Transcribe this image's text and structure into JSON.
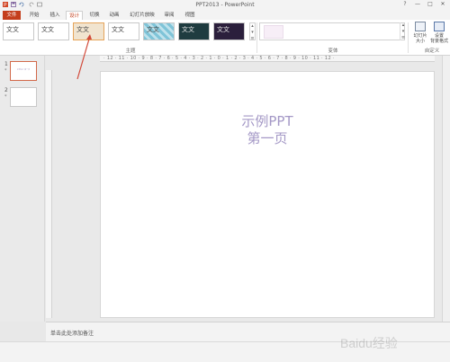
{
  "window": {
    "title": "PPT2013 - PowerPoint",
    "controls": [
      "?",
      "—",
      "□",
      "✕"
    ]
  },
  "tabs": [
    "文件",
    "开始",
    "插入",
    "设计",
    "切换",
    "动画",
    "幻灯片放映",
    "审阅",
    "视图"
  ],
  "active_tab": "设计",
  "ribbon": {
    "themes": [
      "文文",
      "文文",
      "文文",
      "文文",
      "文文",
      "文文",
      "文文",
      "文文"
    ],
    "groups": {
      "themes_label": "主题",
      "variants_label": "变体",
      "customize_label": "自定义"
    },
    "buttons": {
      "slide_size": "幻灯片\n大小",
      "format_background": "设置\n背景格式"
    }
  },
  "thumbnails": [
    {
      "number": "1",
      "marker": "*",
      "text": "示例PPT 第一页"
    },
    {
      "number": "2",
      "marker": "*",
      "text": ""
    }
  ],
  "ruler_labels": "· 12 · 11 · 10 · 9 · 8 · 7 · 6 · 5 · 4 · 3 · 2 · 1 · 0 · 1 · 2 · 3 · 4 · 5 · 6 · 7 · 8 · 9 · 10 · 11 · 12 ·",
  "slide": {
    "line1": "示例PPT",
    "line2": "第一页"
  },
  "notes_placeholder": "单击此处添加备注",
  "watermark": "Baidu经验",
  "colors": {
    "accent": "#c43e1c",
    "slide_text": "#a498c6",
    "annotation_arrow": "#d24a3a"
  }
}
